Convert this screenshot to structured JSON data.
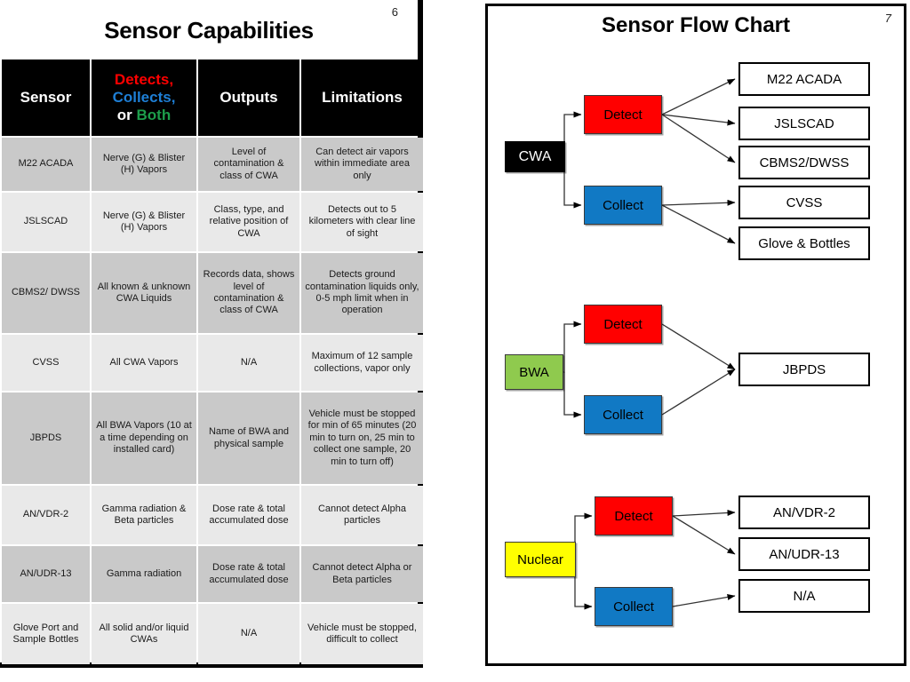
{
  "left_slide": {
    "page_number": "6",
    "title": "Sensor Capabilities",
    "table": {
      "headers": {
        "sensor": "Sensor",
        "agent_line1": "Detects,",
        "agent_line2": "Collects,",
        "agent_line3_or": "or ",
        "agent_line3_both": "Both",
        "outputs": "Outputs",
        "limitations": "Limitations"
      },
      "rows": [
        {
          "sensor": "M22 ACADA",
          "agent": "Nerve (G) & Blister (H) Vapors",
          "agent_color": "red",
          "outputs": "Level of contamination & class of CWA",
          "limitations": "Can detect air vapors within immediate area only"
        },
        {
          "sensor": "JSLSCAD",
          "agent": "Nerve (G) & Blister (H) Vapors",
          "agent_color": "red",
          "outputs": "Class, type, and relative position of CWA",
          "limitations": "Detects out to 5 kilometers with clear line of sight"
        },
        {
          "sensor": "CBMS2/ DWSS",
          "agent": "All known & unknown CWA Liquids",
          "agent_color": "red",
          "outputs": "Records data, shows level of contamination & class of CWA",
          "limitations": "Detects ground contamination liquids only, 0-5 mph limit when in operation"
        },
        {
          "sensor": "CVSS",
          "agent": "All CWA Vapors",
          "agent_color": "blue",
          "outputs": "N/A",
          "limitations": "Maximum of 12 sample collections, vapor only"
        },
        {
          "sensor": "JBPDS",
          "agent": "All BWA Vapors (10 at a time depending on installed card)",
          "agent_color": "green",
          "outputs": "Name of BWA and physical sample",
          "limitations": "Vehicle must be stopped for min of 65 minutes (20 min to turn on, 25 min to collect one sample, 20 min to turn off)"
        },
        {
          "sensor": "AN/VDR-2",
          "agent": "Gamma radiation & Beta particles",
          "agent_color": "red",
          "outputs": "Dose rate & total accumulated dose",
          "limitations": "Cannot detect Alpha particles"
        },
        {
          "sensor": "AN/UDR-13",
          "agent": "Gamma radiation",
          "agent_color": "red",
          "outputs": "Dose rate & total accumulated dose",
          "limitations": "Cannot detect Alpha or Beta particles"
        },
        {
          "sensor": "Glove Port and Sample Bottles",
          "agent": "All solid and/or liquid CWAs",
          "agent_color": "blue",
          "outputs": "N/A",
          "limitations": "Vehicle must be stopped, difficult to collect"
        }
      ]
    }
  },
  "right_slide": {
    "page_number": "7",
    "title": "Sensor Flow Chart",
    "groups": [
      {
        "source": "CWA",
        "source_color": "#000000",
        "actions": [
          {
            "label": "Detect",
            "color": "#ff0000"
          },
          {
            "label": "Collect",
            "color": "#1179c4"
          }
        ],
        "outputs": [
          "M22 ACADA",
          "JSLSCAD",
          "CBMS2/DWSS",
          "CVSS",
          "Glove & Bottles"
        ]
      },
      {
        "source": "BWA",
        "source_color": "#8fca4e",
        "actions": [
          {
            "label": "Detect",
            "color": "#ff0000"
          },
          {
            "label": "Collect",
            "color": "#1179c4"
          }
        ],
        "outputs": [
          "JBPDS"
        ]
      },
      {
        "source": "Nuclear",
        "source_color": "#ffff00",
        "actions": [
          {
            "label": "Detect",
            "color": "#ff0000"
          },
          {
            "label": "Collect",
            "color": "#1179c4"
          }
        ],
        "outputs": [
          "AN/VDR-2",
          "AN/UDR-13",
          "N/A"
        ]
      }
    ]
  }
}
